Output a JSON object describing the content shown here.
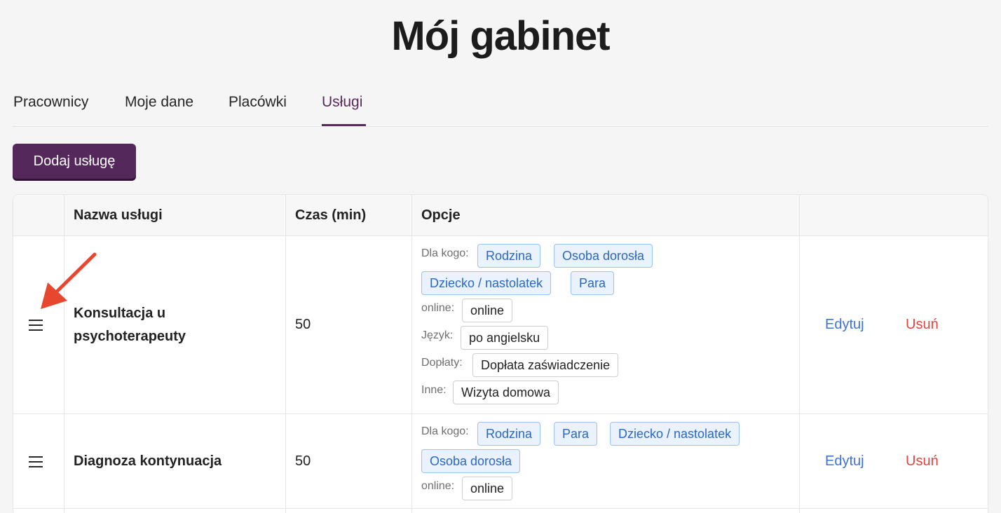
{
  "page": {
    "title": "Mój gabinet"
  },
  "tabs": [
    {
      "label": "Pracownicy",
      "active": false
    },
    {
      "label": "Moje dane",
      "active": false
    },
    {
      "label": "Placówki",
      "active": false
    },
    {
      "label": "Usługi",
      "active": true
    }
  ],
  "add_button": {
    "label": "Dodaj usługę"
  },
  "table": {
    "headers": {
      "name": "Nazwa usługi",
      "duration": "Czas (min)",
      "options": "Opcje",
      "actions": ""
    },
    "rows": [
      {
        "name": "Konsultacja u psychoterapeuty",
        "duration": "50",
        "options": {
          "for_whom_label": "Dla kogo:",
          "for_whom": [
            "Rodzina",
            "Osoba dorosła",
            "Dziecko / nastolatek",
            "Para"
          ],
          "online_label": "online:",
          "online": "online",
          "language_label": "Język:",
          "language": "po angielsku",
          "surcharges_label": "Dopłaty:",
          "surcharges": "Dopłata zaświadczenie",
          "other_label": "Inne:",
          "other": "Wizyta domowa"
        },
        "edit_label": "Edytuj",
        "delete_label": "Usuń"
      },
      {
        "name": "Diagnoza kontynuacja",
        "duration": "50",
        "options": {
          "for_whom_label": "Dla kogo:",
          "for_whom": [
            "Rodzina",
            "Para",
            "Dziecko / nastolatek",
            "Osoba dorosła"
          ],
          "online_label": "online:",
          "online": "online"
        },
        "edit_label": "Edytuj",
        "delete_label": "Usuń"
      }
    ]
  },
  "icons": {
    "drag_handle": "hamburger-icon",
    "annotation": "red-arrow"
  },
  "colors": {
    "brand": "#54285a",
    "active_tab": "#5a2a5e",
    "edit_link": "#3b73d6",
    "delete_link": "#e0453e",
    "tag_blue_bg": "#e9f2fd",
    "tag_blue_text": "#2b67c7",
    "annotation_arrow": "#e8472f"
  }
}
